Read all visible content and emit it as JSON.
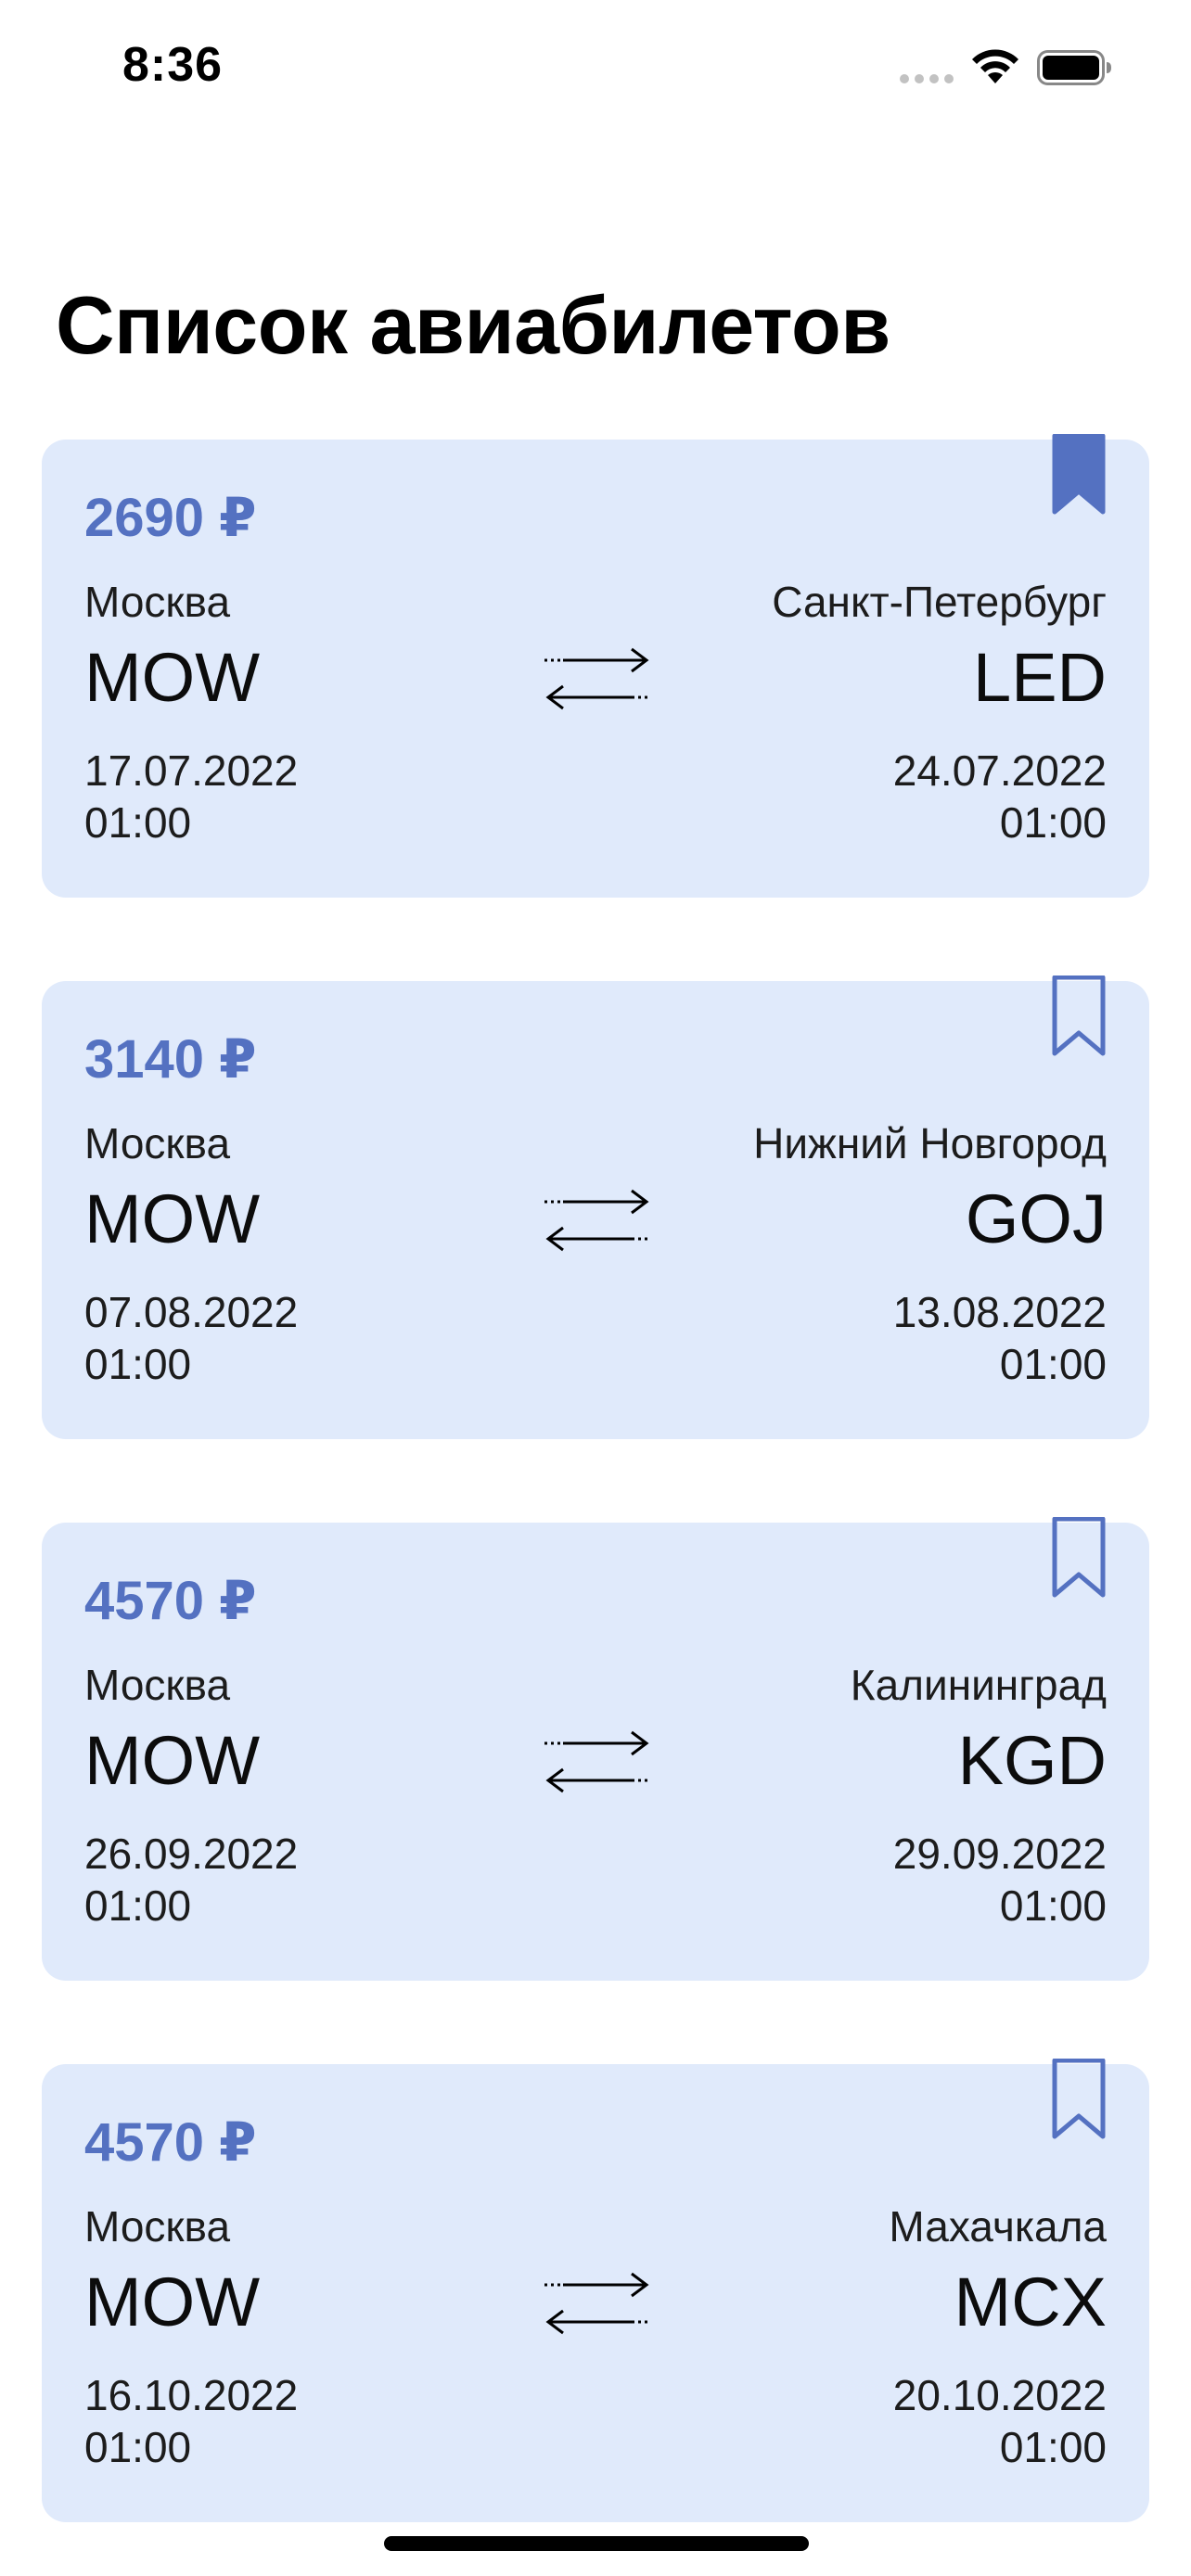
{
  "status_bar": {
    "time": "8:36"
  },
  "page": {
    "title": "Список авиабилетов"
  },
  "colors": {
    "card_background": "#e0eafb",
    "accent": "#5471c1"
  },
  "tickets": [
    {
      "price": "2690 ₽",
      "origin_city": "Москва",
      "origin_code": "MOW",
      "destination_city": "Санкт-Петербург",
      "destination_code": "LED",
      "depart_date": "17.07.2022",
      "depart_time": "01:00",
      "return_date": "24.07.2022",
      "return_time": "01:00",
      "bookmarked": true
    },
    {
      "price": "3140 ₽",
      "origin_city": "Москва",
      "origin_code": "MOW",
      "destination_city": "Нижний Новгород",
      "destination_code": "GOJ",
      "depart_date": "07.08.2022",
      "depart_time": "01:00",
      "return_date": "13.08.2022",
      "return_time": "01:00",
      "bookmarked": false
    },
    {
      "price": "4570 ₽",
      "origin_city": "Москва",
      "origin_code": "MOW",
      "destination_city": "Калининград",
      "destination_code": "KGD",
      "depart_date": "26.09.2022",
      "depart_time": "01:00",
      "return_date": "29.09.2022",
      "return_time": "01:00",
      "bookmarked": false
    },
    {
      "price": "4570 ₽",
      "origin_city": "Москва",
      "origin_code": "MOW",
      "destination_city": "Махачкала",
      "destination_code": "MCX",
      "depart_date": "16.10.2022",
      "depart_time": "01:00",
      "return_date": "20.10.2022",
      "return_time": "01:00",
      "bookmarked": false
    }
  ],
  "icons": {
    "bookmark": "bookmark-icon",
    "swap": "round-trip-arrows-icon",
    "wifi": "wifi-icon",
    "battery": "battery-icon",
    "signal": "cellular-signal-icon"
  }
}
